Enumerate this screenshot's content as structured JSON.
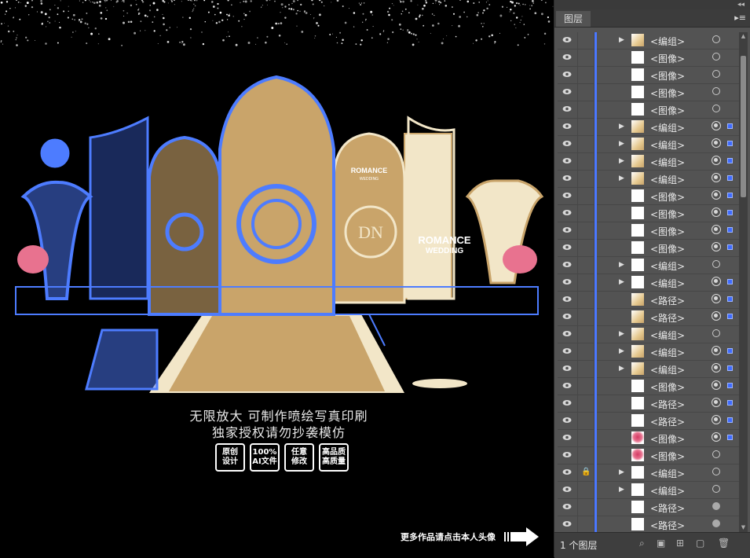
{
  "canvas": {
    "caption_line1": "无限放大  可制作喷绘写真印刷",
    "caption_line2": "独家授权请勿抄袭模仿",
    "badges": [
      {
        "line1": "原创",
        "line2": "设计"
      },
      {
        "line1": "100%",
        "line2": "AI文件"
      },
      {
        "line1": "任意",
        "line2": "修改"
      },
      {
        "line1": "高品质",
        "line2": "高质量"
      }
    ],
    "more_text": "更多作品请点击本人头像",
    "sign_left": {
      "line1": "ROMANCE",
      "line2": "WEDDING"
    },
    "sign_right": {
      "line1": "ROMANCE",
      "line2": "WEDDING"
    },
    "monogram": "DN",
    "colors": {
      "background": "#000000",
      "gold": "#c9a46a",
      "cream": "#f2e6c8",
      "selection": "#4d7cff"
    }
  },
  "panel": {
    "collapse": "◂◂",
    "close": "✕",
    "tab_label": "图层",
    "menu_icon": "panel-menu-icon",
    "layer_count": "1 个图层",
    "rows": [
      {
        "name": "<编组>",
        "tri": true,
        "thumb": "gold",
        "lock": false,
        "target": "ring",
        "selected": false
      },
      {
        "name": "<图像>",
        "tri": false,
        "thumb": "white",
        "lock": false,
        "target": "ring",
        "selected": false
      },
      {
        "name": "<图像>",
        "tri": false,
        "thumb": "white",
        "lock": false,
        "target": "ring",
        "selected": false
      },
      {
        "name": "<图像>",
        "tri": false,
        "thumb": "white",
        "lock": false,
        "target": "ring",
        "selected": false
      },
      {
        "name": "<图像>",
        "tri": false,
        "thumb": "white",
        "lock": false,
        "target": "ring",
        "selected": false
      },
      {
        "name": "<编组>",
        "tri": true,
        "thumb": "gold",
        "lock": false,
        "target": "sel",
        "selected": true
      },
      {
        "name": "<编组>",
        "tri": true,
        "thumb": "gold",
        "lock": false,
        "target": "sel",
        "selected": true
      },
      {
        "name": "<编组>",
        "tri": true,
        "thumb": "gold",
        "lock": false,
        "target": "sel",
        "selected": true
      },
      {
        "name": "<编组>",
        "tri": true,
        "thumb": "gold",
        "lock": false,
        "target": "sel",
        "selected": true
      },
      {
        "name": "<图像>",
        "tri": false,
        "thumb": "white",
        "lock": false,
        "target": "sel",
        "selected": true
      },
      {
        "name": "<图像>",
        "tri": false,
        "thumb": "white",
        "lock": false,
        "target": "sel",
        "selected": true
      },
      {
        "name": "<图像>",
        "tri": false,
        "thumb": "white",
        "lock": false,
        "target": "sel",
        "selected": true
      },
      {
        "name": "<图像>",
        "tri": false,
        "thumb": "white",
        "lock": false,
        "target": "sel",
        "selected": true
      },
      {
        "name": "<编组>",
        "tri": true,
        "thumb": "white",
        "lock": false,
        "target": "ring",
        "selected": false
      },
      {
        "name": "<编组>",
        "tri": true,
        "thumb": "white",
        "lock": false,
        "target": "sel",
        "selected": true
      },
      {
        "name": "<路径>",
        "tri": false,
        "thumb": "gold",
        "lock": false,
        "target": "sel",
        "selected": true
      },
      {
        "name": "<路径>",
        "tri": false,
        "thumb": "gold",
        "lock": false,
        "target": "sel",
        "selected": true
      },
      {
        "name": "<编组>",
        "tri": true,
        "thumb": "gold",
        "lock": false,
        "target": "ring",
        "selected": false
      },
      {
        "name": "<编组>",
        "tri": true,
        "thumb": "gold",
        "lock": false,
        "target": "sel",
        "selected": true
      },
      {
        "name": "<编组>",
        "tri": true,
        "thumb": "gold",
        "lock": false,
        "target": "sel",
        "selected": true
      },
      {
        "name": "<图像>",
        "tri": false,
        "thumb": "white",
        "lock": false,
        "target": "sel",
        "selected": true
      },
      {
        "name": "<路径>",
        "tri": false,
        "thumb": "white",
        "lock": false,
        "target": "sel",
        "selected": true
      },
      {
        "name": "<路径>",
        "tri": false,
        "thumb": "white",
        "lock": false,
        "target": "sel",
        "selected": true
      },
      {
        "name": "<图像>",
        "tri": false,
        "thumb": "flower",
        "lock": false,
        "target": "sel",
        "selected": true
      },
      {
        "name": "<图像>",
        "tri": false,
        "thumb": "flower",
        "lock": false,
        "target": "ring",
        "selected": false
      },
      {
        "name": "<编组>",
        "tri": true,
        "thumb": "white",
        "lock": true,
        "target": "ring",
        "selected": false
      },
      {
        "name": "<编组>",
        "tri": true,
        "thumb": "white",
        "lock": false,
        "target": "ring",
        "selected": false
      },
      {
        "name": "<路径>",
        "tri": false,
        "thumb": "white",
        "lock": false,
        "target": "fill",
        "selected": false
      },
      {
        "name": "<路径>",
        "tri": false,
        "thumb": "white",
        "lock": false,
        "target": "fill",
        "selected": false
      },
      {
        "name": "<路径>",
        "tri": false,
        "thumb": "white",
        "lock": false,
        "target": "fill",
        "selected": false
      }
    ]
  }
}
